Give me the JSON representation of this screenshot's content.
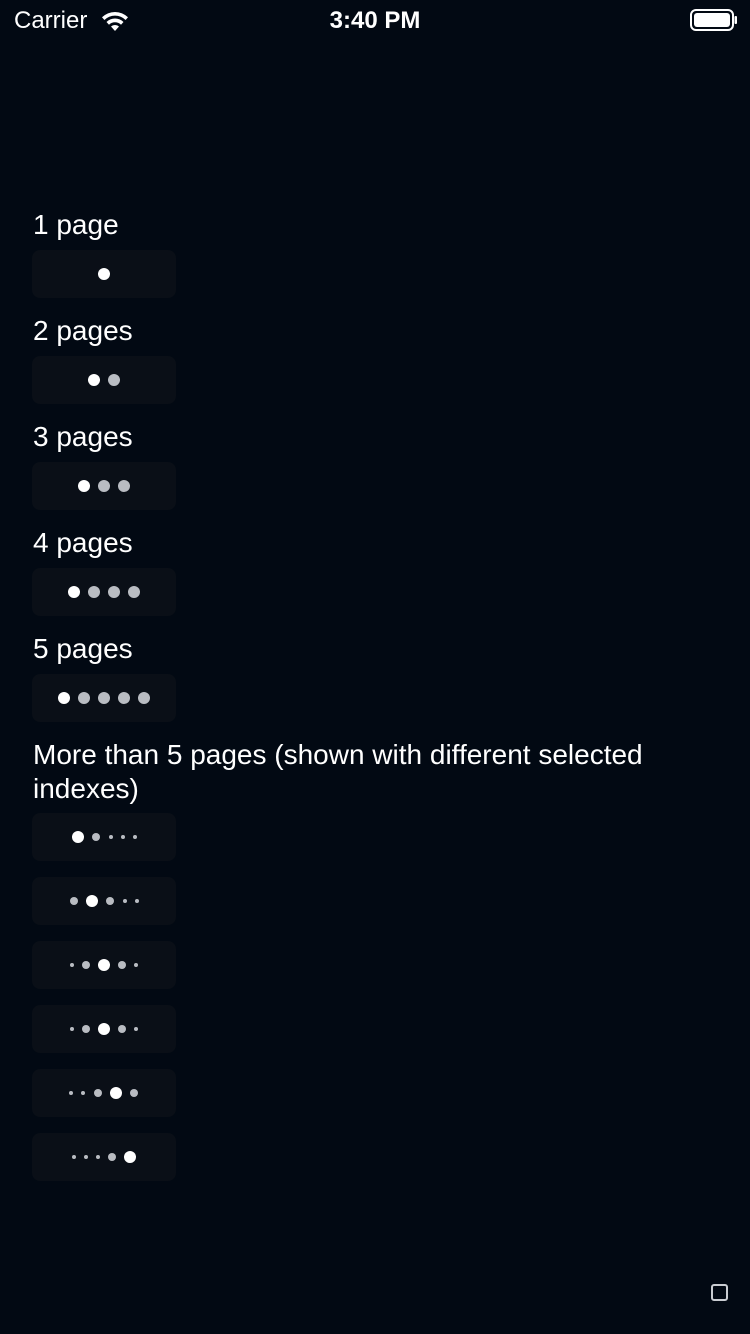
{
  "status_bar": {
    "carrier": "Carrier",
    "time": "3:40 PM",
    "wifi_icon": "wifi-icon",
    "battery_icon": "battery-icon"
  },
  "sections": [
    {
      "label": "1 page",
      "pages": 1,
      "selected_index": 0
    },
    {
      "label": "2 pages",
      "pages": 2,
      "selected_index": 0
    },
    {
      "label": "3 pages",
      "pages": 3,
      "selected_index": 0
    },
    {
      "label": "4 pages",
      "pages": 4,
      "selected_index": 0
    },
    {
      "label": "5 pages",
      "pages": 5,
      "selected_index": 0
    }
  ],
  "more_section": {
    "label": "More than 5 pages (shown with different selected indexes)",
    "indicators": [
      {
        "dots": [
          "active",
          "small",
          "tiny",
          "tiny",
          "tiny"
        ]
      },
      {
        "dots": [
          "small",
          "active",
          "small",
          "tiny",
          "tiny"
        ]
      },
      {
        "dots": [
          "tiny",
          "small",
          "active",
          "small",
          "tiny"
        ]
      },
      {
        "dots": [
          "tiny",
          "small",
          "active",
          "small",
          "tiny"
        ]
      },
      {
        "dots": [
          "tiny",
          "tiny",
          "small",
          "active",
          "small"
        ]
      },
      {
        "dots": [
          "tiny",
          "tiny",
          "tiny",
          "small",
          "active"
        ]
      }
    ]
  },
  "colors": {
    "background": "#020913",
    "pager_background": "#0a0f17",
    "active_dot": "#ffffff",
    "inactive_dot": "#b9bcc2"
  },
  "corner_icon": "square-outline-icon"
}
